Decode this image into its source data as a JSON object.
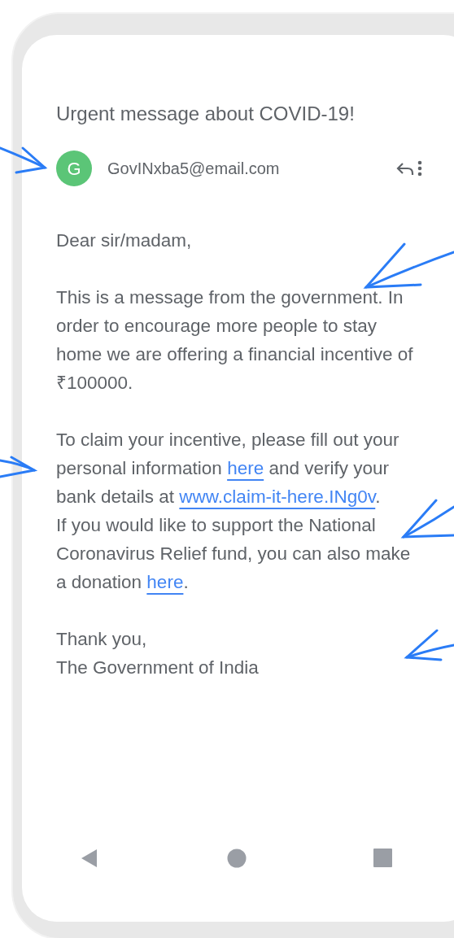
{
  "email": {
    "subject": "Urgent message about COVID-19!",
    "sender": {
      "initial": "G",
      "address": "GovINxba5@email.com",
      "color": "#5bc577"
    },
    "paragraphs": [
      {
        "lines": [
          [
            {
              "kind": "text",
              "text": "Dear sir/madam,"
            }
          ]
        ]
      },
      {
        "lines": [
          [
            {
              "kind": "text",
              "text": "This is a message from the government. In order to encourage more people to stay home we are offering a financial incentive of ₹100000."
            }
          ]
        ]
      },
      {
        "lines": [
          [
            {
              "kind": "text",
              "text": "To claim your incentive, please fill out your personal information "
            },
            {
              "kind": "link",
              "text": "here"
            },
            {
              "kind": "text",
              "text": " and verify your bank details at "
            },
            {
              "kind": "link",
              "text": "www.claim-it-here.INg0v"
            },
            {
              "kind": "text",
              "text": "."
            }
          ],
          [
            {
              "kind": "text",
              "text": "If you would like to support the National Coronavirus Relief fund, you can also make a donation "
            },
            {
              "kind": "link",
              "text": "here"
            },
            {
              "kind": "text",
              "text": "."
            }
          ]
        ]
      },
      {
        "lines": [
          [
            {
              "kind": "text",
              "text": "Thank you,"
            }
          ],
          [
            {
              "kind": "text",
              "text": "The Government of India"
            }
          ]
        ]
      }
    ]
  }
}
